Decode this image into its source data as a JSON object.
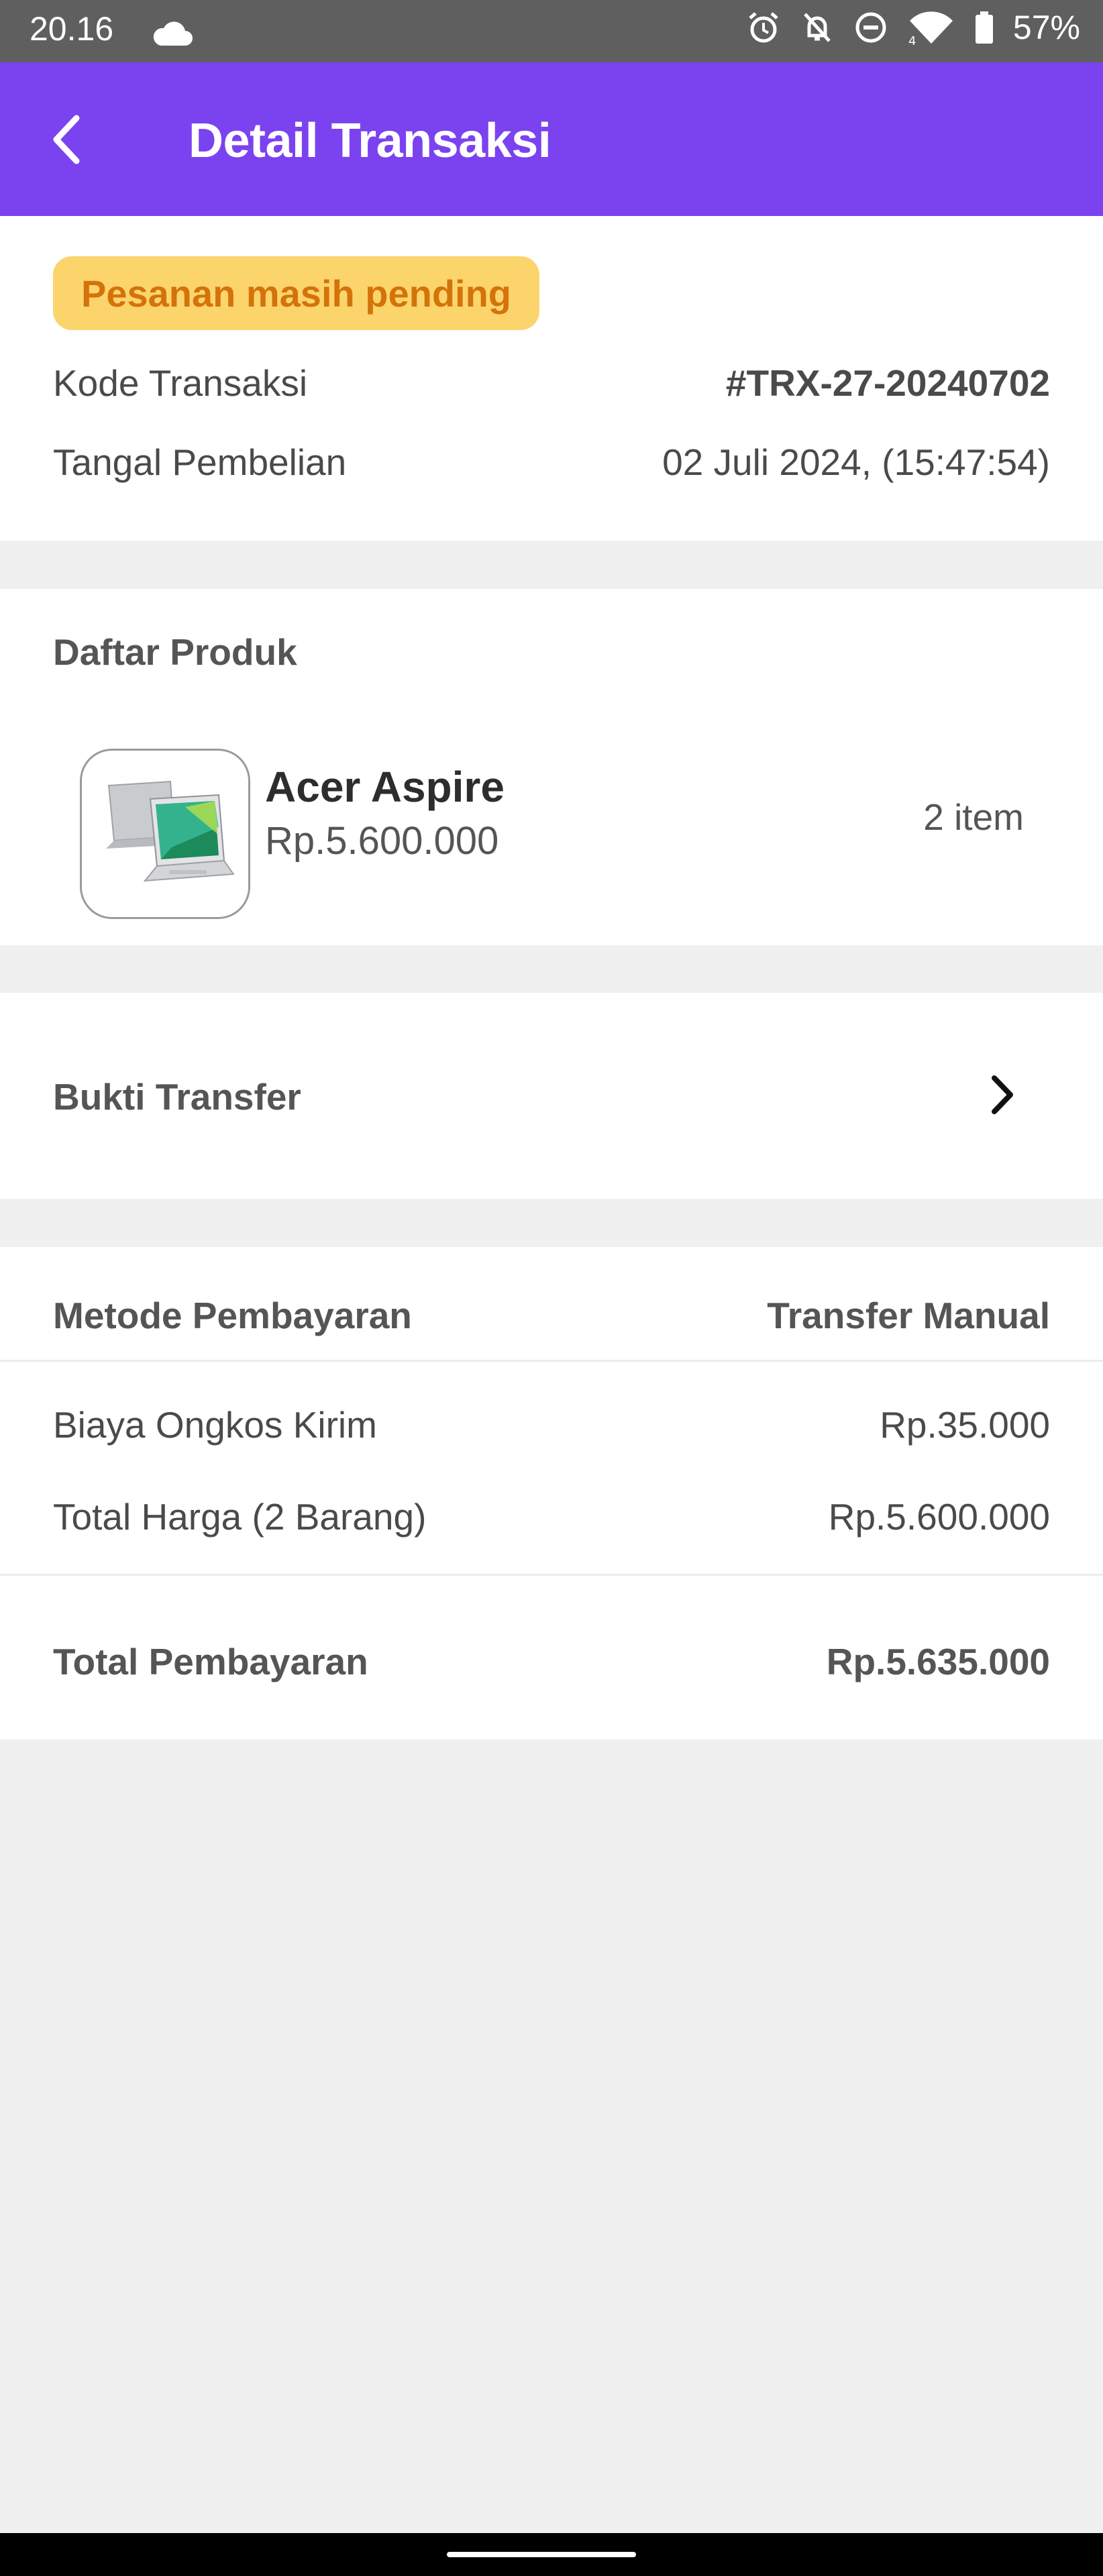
{
  "status_bar": {
    "time": "20.16",
    "battery": "57%",
    "icons": [
      "cloud-icon",
      "alarm-icon",
      "notifications-off-icon",
      "do-not-disturb-icon",
      "wifi-icon",
      "battery-icon"
    ]
  },
  "app_bar": {
    "title": "Detail Transaksi",
    "color": "#7b42f0"
  },
  "order_status": {
    "badge": "Pesanan masih pending",
    "badge_bg": "#fcd46c",
    "badge_text_color": "#d4730a",
    "code_label": "Kode Transaksi",
    "code_value": "#TRX-27-20240702",
    "date_label": "Tangal Pembelian",
    "date_value": "02 Juli 2024, (15:47:54)"
  },
  "products": {
    "title": "Daftar Produk",
    "items": [
      {
        "name": "Acer Aspire",
        "price": "Rp.5.600.000",
        "qty": "2 item",
        "image": "laptop-image"
      }
    ]
  },
  "proof": {
    "label": "Bukti Transfer"
  },
  "payment": {
    "method_label": "Metode Pembayaran",
    "method_value": "Transfer Manual",
    "shipping_label": "Biaya Ongkos Kirim",
    "shipping_value": "Rp.35.000",
    "subtotal_label": "Total Harga (2 Barang)",
    "subtotal_value": "Rp.5.600.000",
    "total_label": "Total Pembayaran",
    "total_value": "Rp.5.635.000"
  }
}
